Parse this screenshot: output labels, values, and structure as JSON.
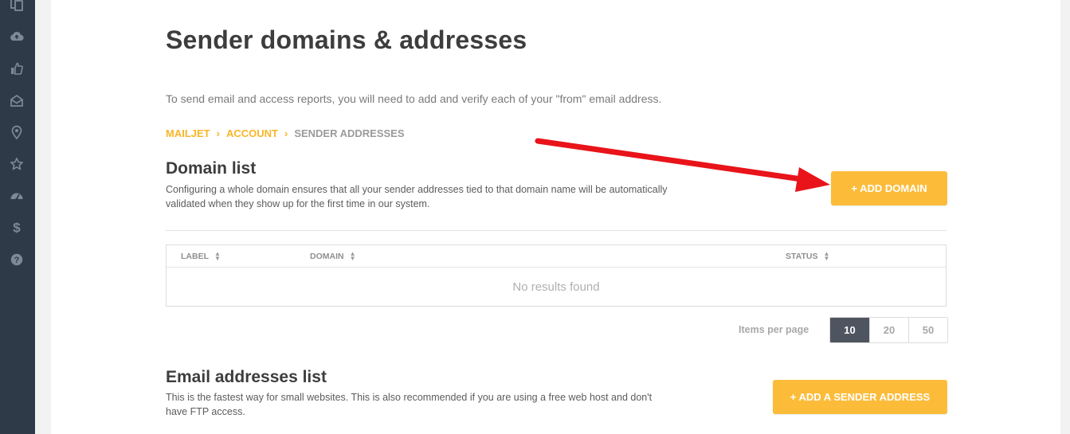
{
  "sidebar": {
    "icons": [
      "document-icon",
      "cloud-upload-icon",
      "thumbs-up-icon",
      "envelope-open-icon",
      "map-pin-icon",
      "star-icon",
      "dashboard-gauge-icon",
      "dollar-icon",
      "help-icon"
    ]
  },
  "header": {
    "title": "Sender domains & addresses",
    "intro": "To send email and access reports, you will need to add and verify each of your \"from\" email address."
  },
  "breadcrumb": {
    "items": [
      "MAILJET",
      "ACCOUNT"
    ],
    "current": "SENDER ADDRESSES",
    "separator": "›"
  },
  "domain_section": {
    "title": "Domain list",
    "description": "Configuring a whole domain ensures that all your sender addresses tied to that domain name will be automatically validated when they show up for the first time in our system.",
    "add_button": "+ ADD DOMAIN",
    "table": {
      "columns": [
        "LABEL",
        "DOMAIN",
        "STATUS"
      ],
      "empty_text": "No results found"
    },
    "pagination": {
      "label": "Items per page",
      "options": [
        "10",
        "20",
        "50"
      ],
      "selected": "10"
    }
  },
  "email_section": {
    "title": "Email addresses list",
    "description": "This is the fastest way for small websites. This is also recommended if you are using a free web host and don't have FTP access.",
    "add_button": "+ ADD A SENDER ADDRESS"
  },
  "colors": {
    "sidebar": "#2f3a49",
    "accent": "#fcbc3a",
    "breadcrumb_link": "#f8b627",
    "annotation_arrow": "#e8141a",
    "pager_active": "#4f5560"
  }
}
